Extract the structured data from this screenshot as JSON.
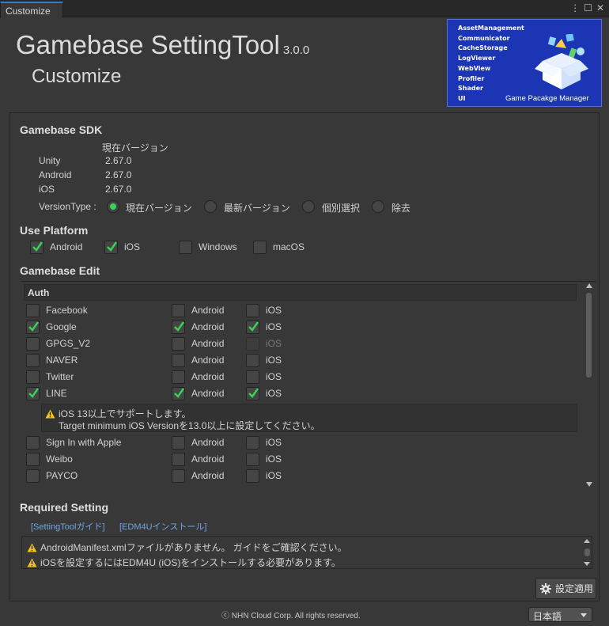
{
  "window": {
    "tab_title": "Customize",
    "controls": [
      "⋮",
      "☐",
      "✕"
    ]
  },
  "header": {
    "title": "Gamebase SettingTool",
    "version": "3.0.0",
    "subtitle": "Customize"
  },
  "banner": {
    "items": [
      "AssetManagement",
      "Communicator",
      "CacheStorage",
      "LogViewer",
      "WebView",
      "Profiler",
      "Shader",
      "UI"
    ],
    "caption": "Game Pacakge Manager"
  },
  "sdk": {
    "heading": "Gamebase SDK",
    "current_version_label": "現在バージョン",
    "versions": [
      {
        "platform": "Unity",
        "version": "2.67.0"
      },
      {
        "platform": "Android",
        "version": "2.67.0"
      },
      {
        "platform": "iOS",
        "version": "2.67.0"
      }
    ],
    "version_type_label": "VersionType :",
    "version_type_options": [
      {
        "label": "現在バージョン",
        "selected": true
      },
      {
        "label": "最新バージョン",
        "selected": false
      },
      {
        "label": "個別選択",
        "selected": false
      },
      {
        "label": "除去",
        "selected": false
      }
    ]
  },
  "platform": {
    "heading": "Use Platform",
    "options": [
      {
        "label": "Android",
        "checked": true
      },
      {
        "label": "iOS",
        "checked": true
      },
      {
        "label": "Windows",
        "checked": false
      },
      {
        "label": "macOS",
        "checked": false
      }
    ]
  },
  "edit": {
    "heading": "Gamebase Edit",
    "section": "Auth",
    "rows": [
      {
        "name": "Facebook",
        "enabled": false,
        "android": false,
        "ios": false,
        "ios_disabled": false
      },
      {
        "name": "Google",
        "enabled": true,
        "android": true,
        "ios": true,
        "ios_disabled": false
      },
      {
        "name": "GPGS_V2",
        "enabled": false,
        "android": false,
        "ios": false,
        "ios_disabled": true
      },
      {
        "name": "NAVER",
        "enabled": false,
        "android": false,
        "ios": false,
        "ios_disabled": false
      },
      {
        "name": "Twitter",
        "enabled": false,
        "android": false,
        "ios": false,
        "ios_disabled": false
      },
      {
        "name": "LINE",
        "enabled": true,
        "android": true,
        "ios": true,
        "ios_disabled": false
      },
      {
        "name": "Sign In with Apple",
        "enabled": false,
        "android": false,
        "ios": false,
        "ios_disabled": false
      },
      {
        "name": "Weibo",
        "enabled": false,
        "android": false,
        "ios": false,
        "ios_disabled": false
      },
      {
        "name": "PAYCO",
        "enabled": false,
        "android": false,
        "ios": false,
        "ios_disabled": false
      }
    ],
    "android_label": "Android",
    "ios_label": "iOS",
    "line_warning": [
      "iOS 13以上でサポートします。",
      "Target minimum iOS Versionを13.0以上に設定してください。"
    ]
  },
  "required": {
    "heading": "Required Setting",
    "links": [
      "[SettingToolガイド]",
      "[EDM4Uインストール]"
    ],
    "messages": [
      "AndroidManifest.xmlファイルがありません。 ガイドをご確認ください。",
      "iOSを設定するにはEDM4U (iOS)をインストールする必要があります。"
    ]
  },
  "footer": {
    "apply_label": "設定適用",
    "copyright": "ⓒ NHN Cloud Corp. All rights reserved.",
    "language": "日本語"
  },
  "colors": {
    "accent_green": "#37d457",
    "link_blue": "#6ea6e6",
    "warning_yellow": "#f5c518",
    "banner_blue": "#1b35b5"
  }
}
